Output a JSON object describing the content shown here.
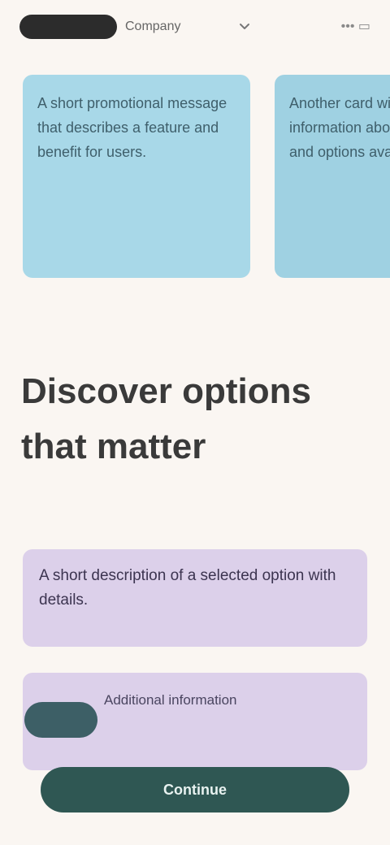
{
  "header": {
    "brand_text": "Company",
    "action_text": "••• ▭"
  },
  "cards": [
    {
      "text": "A short promotional message that describes a feature and benefit for users."
    },
    {
      "text": "Another card with more information about services and options available."
    }
  ],
  "section": {
    "title": "Discover options that matter"
  },
  "info_cards": [
    {
      "text": "A short description of a selected option with details."
    },
    {
      "text": "Additional information"
    }
  ],
  "cta": {
    "label": "Continue"
  }
}
